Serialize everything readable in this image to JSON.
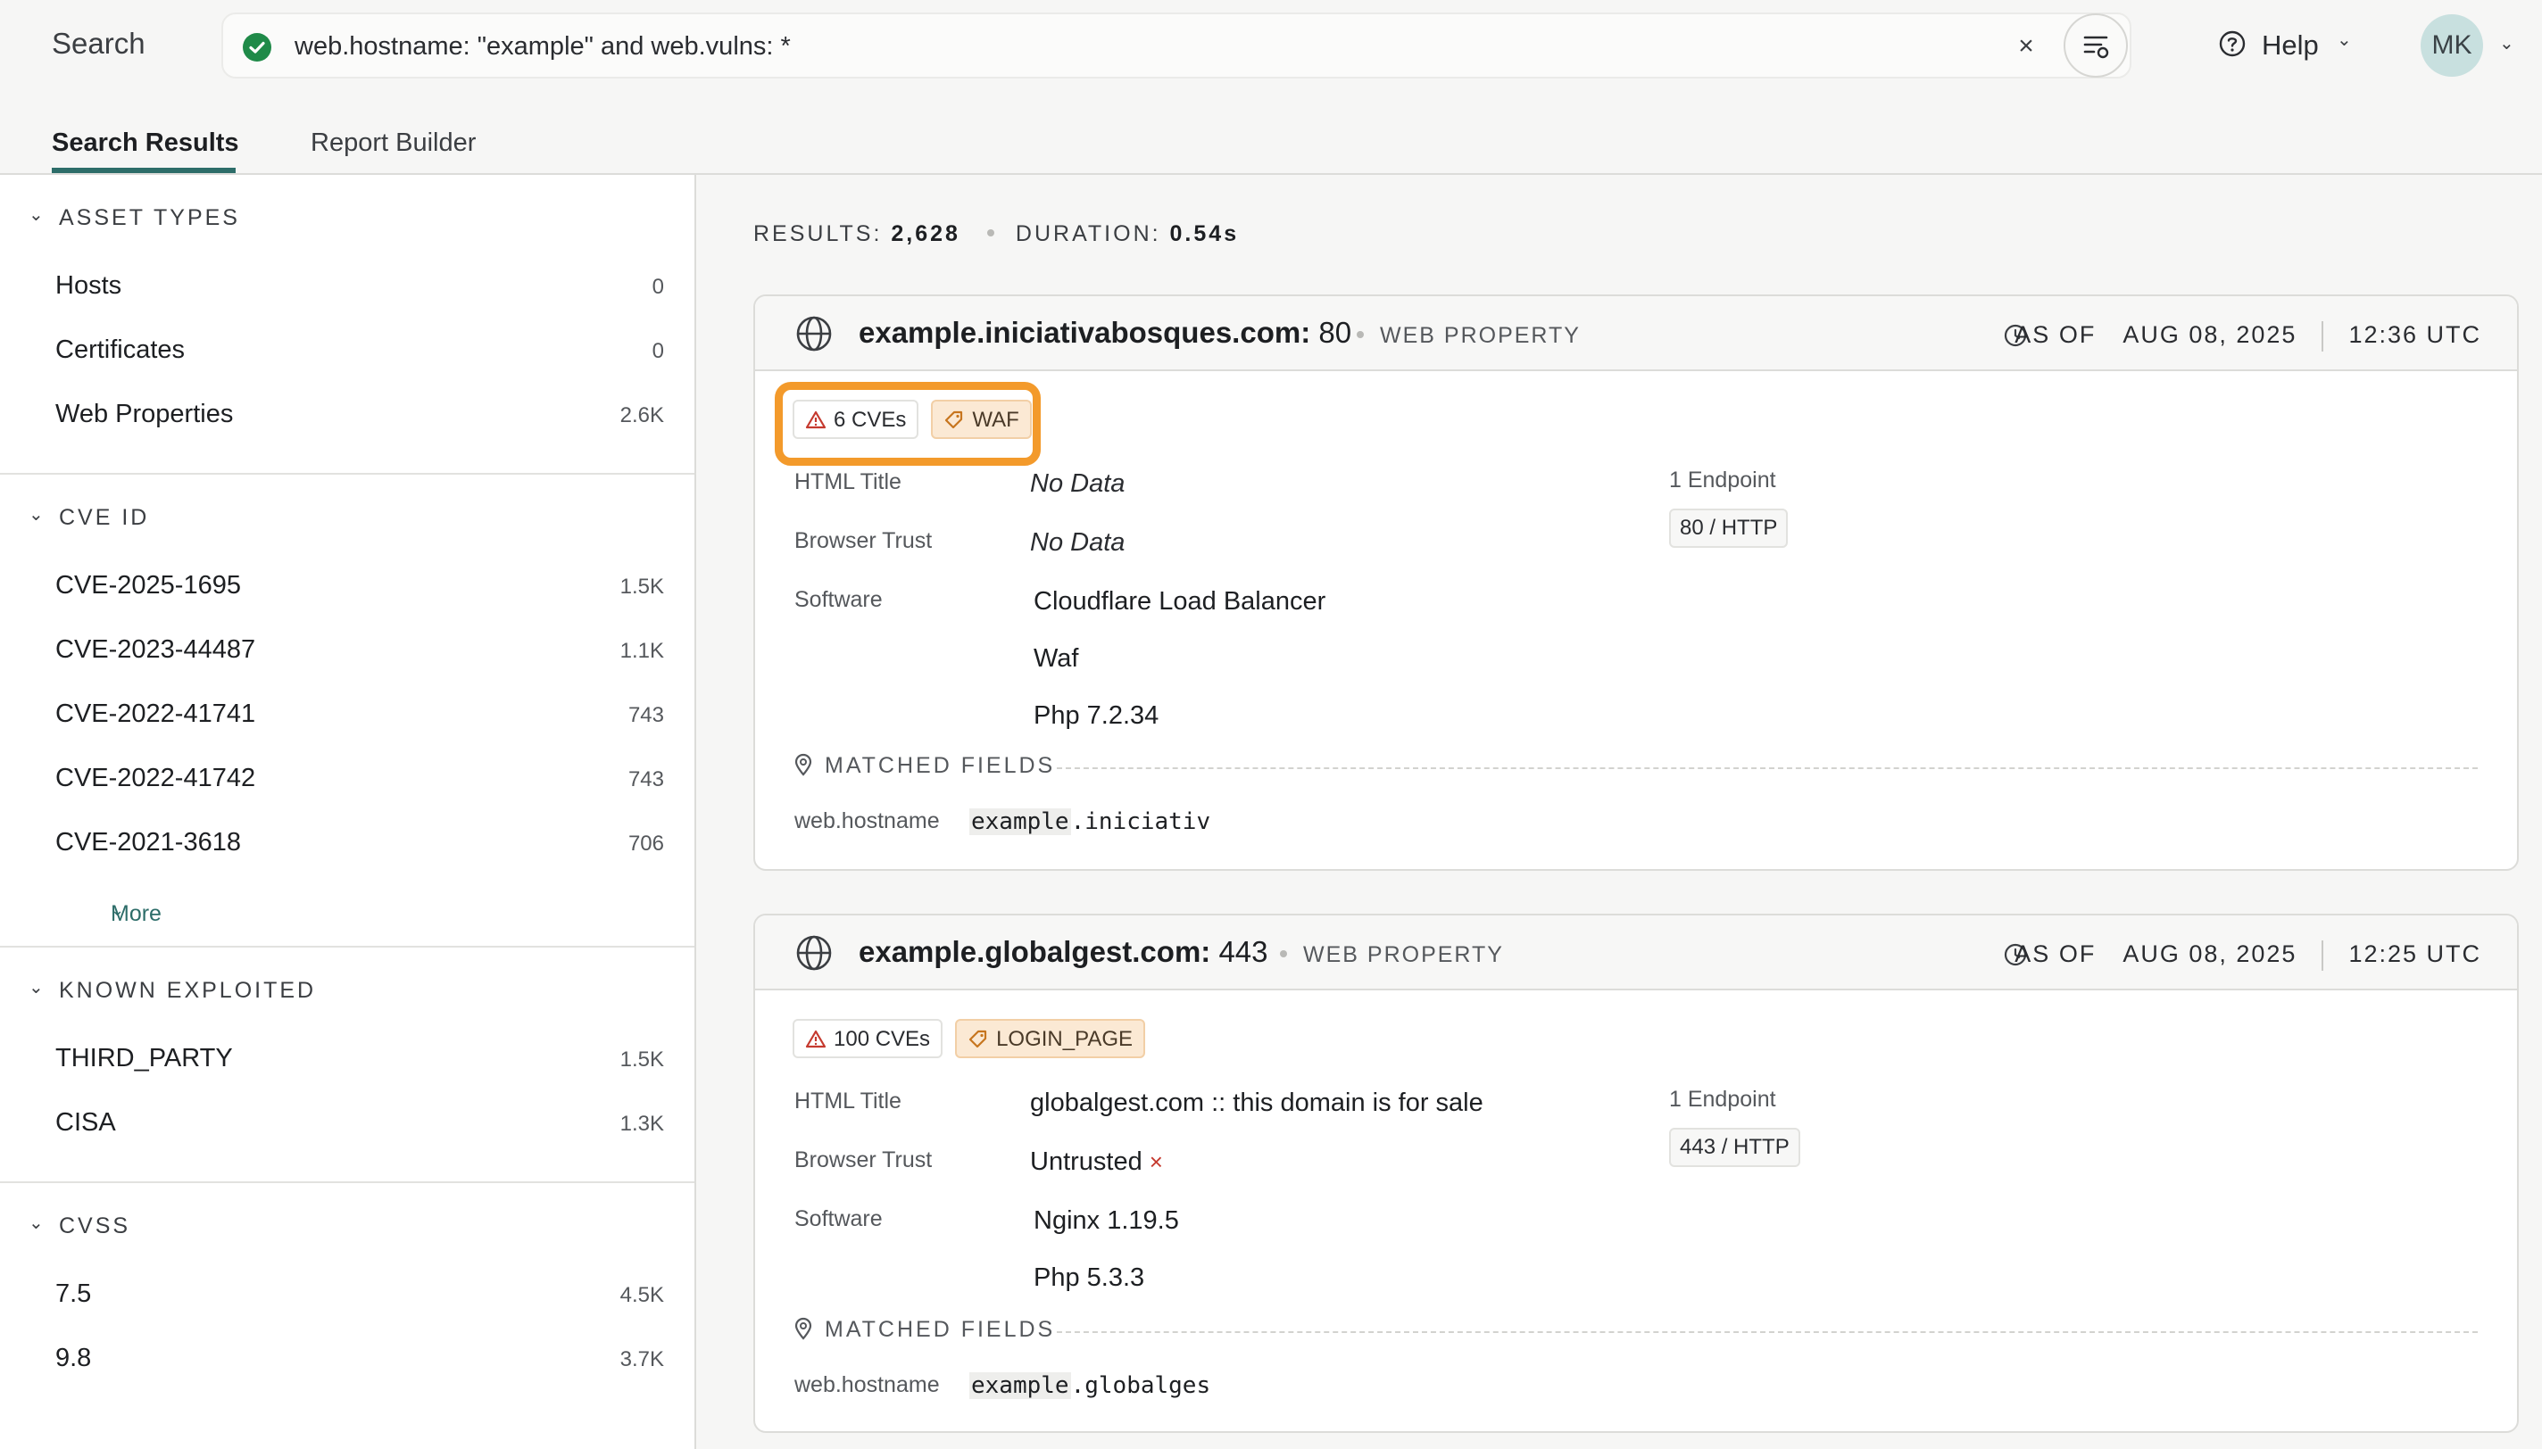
{
  "header": {
    "search_label": "Search",
    "query": "web.hostname: \"example\" and web.vulns: *",
    "clear_symbol": "×",
    "help_label": "Help",
    "avatar_initials": "MK"
  },
  "tabs": [
    {
      "label": "Search Results",
      "active": true
    },
    {
      "label": "Report Builder",
      "active": false
    }
  ],
  "sidebar": {
    "asset_types": {
      "title": "ASSET TYPES",
      "items": [
        {
          "label": "Hosts",
          "count": "0"
        },
        {
          "label": "Certificates",
          "count": "0"
        },
        {
          "label": "Web Properties",
          "count": "2.6K"
        }
      ]
    },
    "cve_id": {
      "title": "CVE ID",
      "items": [
        {
          "label": "CVE-2025-1695",
          "count": "1.5K"
        },
        {
          "label": "CVE-2023-44487",
          "count": "1.1K"
        },
        {
          "label": "CVE-2022-41741",
          "count": "743"
        },
        {
          "label": "CVE-2022-41742",
          "count": "743"
        },
        {
          "label": "CVE-2021-3618",
          "count": "706"
        }
      ],
      "more_label": "More"
    },
    "known_exploited": {
      "title": "KNOWN EXPLOITED",
      "items": [
        {
          "label": "THIRD_PARTY",
          "count": "1.5K"
        },
        {
          "label": "CISA",
          "count": "1.3K"
        }
      ]
    },
    "cvss": {
      "title": "CVSS",
      "items": [
        {
          "label": "7.5",
          "count": "4.5K"
        },
        {
          "label": "9.8",
          "count": "3.7K"
        }
      ]
    }
  },
  "results_meta": {
    "results_label": "RESULTS:",
    "results_value": "2,628",
    "duration_label": "DURATION:",
    "duration_value": "0.54s"
  },
  "cards": [
    {
      "host": "example.iniciativabosques.com:",
      "port": "80",
      "type": "WEB PROPERTY",
      "as_of_label": "AS OF",
      "date": "AUG 08, 2025",
      "time": "12:36 UTC",
      "cve_tag": "6 CVEs",
      "label_tag": "WAF",
      "fields": {
        "html_title_label": "HTML Title",
        "html_title": "No Data",
        "browser_trust_label": "Browser Trust",
        "browser_trust": "No Data",
        "software_label": "Software",
        "software": [
          "Cloudflare Load Balancer",
          "Waf",
          "Php 7.2.34"
        ]
      },
      "endpoints_label": "1 Endpoint",
      "endpoint": "80 / HTTP",
      "matched_title": "MATCHED FIELDS",
      "matched_key": "web.hostname",
      "matched_highlight": "example",
      "matched_rest": ".iniciativ"
    },
    {
      "host": "example.globalgest.com:",
      "port": "443",
      "type": "WEB PROPERTY",
      "as_of_label": "AS OF",
      "date": "AUG 08, 2025",
      "time": "12:25 UTC",
      "cve_tag": "100 CVEs",
      "label_tag": "LOGIN_PAGE",
      "fields": {
        "html_title_label": "HTML Title",
        "html_title": "globalgest.com :: this domain is for sale",
        "browser_trust_label": "Browser Trust",
        "browser_trust": "Untrusted",
        "browser_trust_mark": "×",
        "software_label": "Software",
        "software": [
          "Nginx 1.19.5",
          "Php 5.3.3"
        ]
      },
      "endpoints_label": "1 Endpoint",
      "endpoint": "443 / HTTP",
      "matched_title": "MATCHED FIELDS",
      "matched_key": "web.hostname",
      "matched_highlight": "example",
      "matched_rest": ".globalges"
    }
  ],
  "colors": {
    "accent": "#2d6d69",
    "highlight_ring": "#f39a2b",
    "success": "#1f8a48",
    "danger": "#c53a2f",
    "tag_label_bg": "#fbe9d4"
  },
  "icons": [
    "check-circle-icon",
    "arrow-right-icon",
    "filter-settings-icon",
    "help-circle-icon",
    "chevron-down-icon",
    "globe-icon",
    "clock-icon",
    "warning-triangle-icon",
    "tag-icon",
    "pin-icon"
  ]
}
